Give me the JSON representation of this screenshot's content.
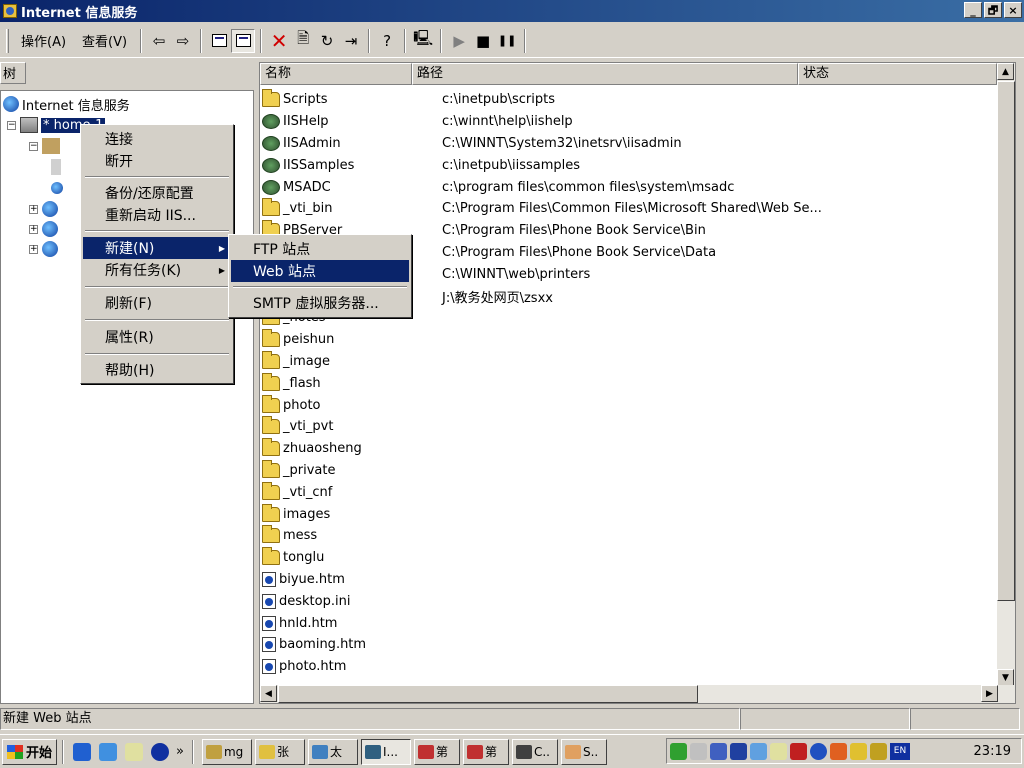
{
  "window": {
    "title": "Internet 信息服务",
    "min": "_",
    "max": "🗗",
    "close": "×"
  },
  "menubar": {
    "action": "操作(A)",
    "view": "查看(V)"
  },
  "toolbar": {
    "back": "⇦",
    "forward": "⇨",
    "up": "⬆",
    "delete": "✕",
    "properties": "🗎",
    "refresh": "↻",
    "export": "⇥",
    "help": "?",
    "connect": "🖳",
    "play": "▶",
    "stop": "■",
    "pause": "❚❚"
  },
  "tree": {
    "header": "树",
    "root": "Internet 信息服务",
    "server": "* home-1"
  },
  "list": {
    "columns": [
      "名称",
      "路径",
      "状态"
    ],
    "rows": [
      {
        "name": "Scripts",
        "path": "c:\\inetpub\\scripts",
        "icon": "vdir-folder-icon"
      },
      {
        "name": "IISHelp",
        "path": "c:\\winnt\\help\\iishelp",
        "icon": "vdir-globe-icon"
      },
      {
        "name": "IISAdmin",
        "path": "C:\\WINNT\\System32\\inetsrv\\iisadmin",
        "icon": "vdir-globe-icon"
      },
      {
        "name": "IISSamples",
        "path": "c:\\inetpub\\iissamples",
        "icon": "vdir-globe-icon"
      },
      {
        "name": "MSADC",
        "path": "c:\\program files\\common files\\system\\msadc",
        "icon": "vdir-globe-icon"
      },
      {
        "name": "_vti_bin",
        "path": "C:\\Program Files\\Common Files\\Microsoft Shared\\Web Se...",
        "icon": "vdir-folder-icon"
      },
      {
        "name": "PBServer",
        "path": "C:\\Program Files\\Phone Book Service\\Bin",
        "icon": "vdir-folder-icon"
      },
      {
        "name": "",
        "path": "C:\\Program Files\\Phone Book Service\\Data",
        "icon": "vdir-folder-icon"
      },
      {
        "name": "",
        "path": "C:\\WINNT\\web\\printers",
        "icon": "vdir-folder-icon"
      },
      {
        "name": "",
        "path": "J:\\教务处网页\\zsxx",
        "icon": "vdir-folder-icon"
      },
      {
        "name": "_notes",
        "path": "",
        "icon": "folder-icon"
      },
      {
        "name": "peishun",
        "path": "",
        "icon": "folder-icon"
      },
      {
        "name": "_image",
        "path": "",
        "icon": "folder-icon"
      },
      {
        "name": "_flash",
        "path": "",
        "icon": "folder-icon"
      },
      {
        "name": "photo",
        "path": "",
        "icon": "folder-icon"
      },
      {
        "name": "_vti_pvt",
        "path": "",
        "icon": "folder-icon"
      },
      {
        "name": "zhuaosheng",
        "path": "",
        "icon": "folder-icon"
      },
      {
        "name": "_private",
        "path": "",
        "icon": "folder-icon"
      },
      {
        "name": "_vti_cnf",
        "path": "",
        "icon": "folder-icon"
      },
      {
        "name": "images",
        "path": "",
        "icon": "folder-icon"
      },
      {
        "name": "mess",
        "path": "",
        "icon": "folder-icon"
      },
      {
        "name": "tonglu",
        "path": "",
        "icon": "folder-icon"
      },
      {
        "name": "biyue.htm",
        "path": "",
        "icon": "htm-file-icon"
      },
      {
        "name": "desktop.ini",
        "path": "",
        "icon": "htm-file-icon"
      },
      {
        "name": "hnld.htm",
        "path": "",
        "icon": "htm-file-icon"
      },
      {
        "name": "baoming.htm",
        "path": "",
        "icon": "htm-file-icon"
      },
      {
        "name": "photo.htm",
        "path": "",
        "icon": "htm-file-icon"
      }
    ]
  },
  "context_menu": {
    "items": [
      "连接",
      "断开",
      "备份/还原配置",
      "重新启动 IIS...",
      "新建(N)",
      "所有任务(K)",
      "刷新(F)",
      "属性(R)",
      "帮助(H)"
    ]
  },
  "submenu": {
    "items": [
      "FTP 站点",
      "Web 站点",
      "SMTP 虚拟服务器..."
    ]
  },
  "statusbar": {
    "text": "新建 Web 站点"
  },
  "taskbar": {
    "start": "开始",
    "more": "»",
    "tasks": [
      "mg",
      "张",
      "太",
      "I...",
      "第",
      "第",
      "C..",
      "S.."
    ],
    "clock": "23:19",
    "lang": "EN"
  }
}
